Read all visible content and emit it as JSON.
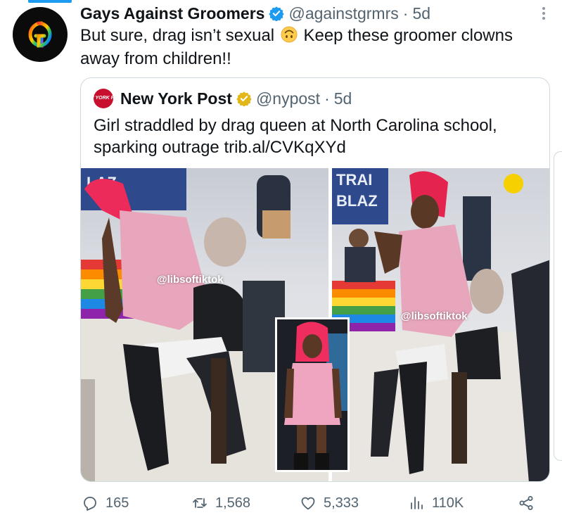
{
  "tweet": {
    "display_name": "Gays Against Groomers",
    "handle": "@againstgrmrs",
    "separator": "·",
    "time": "5d",
    "text_before_emoji": "But sure, drag isn’t sexual ",
    "text_after_emoji": " Keep these groomer clowns away from children!!",
    "avatar_icon": "gg-rainbow-logo-icon",
    "verified_icon": "verified-badge-icon",
    "verified_color": "#1d9bf0",
    "emoji": "upside-down-face-emoji"
  },
  "quote": {
    "display_name": "New York Post",
    "handle": "@nypost",
    "separator": "·",
    "time": "5d",
    "avatar_text": "NEW YORK POST",
    "avatar_color": "#c8102e",
    "verified_icon": "gold-verified-badge-icon",
    "verified_color": "#e2b719",
    "text": "Girl straddled by drag queen at North Carolina school, sparking outrage trib.al/CVKqXYd",
    "media": {
      "watermark_left": "@libsoftiktok",
      "watermark_right": "@libsoftiktok",
      "sign_left": "LAZ",
      "sign_right_line1": "TRAI",
      "sign_right_line2": "BLAZ"
    }
  },
  "actions": {
    "replies": "165",
    "retweets": "1,568",
    "likes": "5,333",
    "views": "110K"
  },
  "colors": {
    "text_primary": "#0f1419",
    "text_secondary": "#536471",
    "border": "#cfd9de",
    "accent": "#1d9bf0"
  }
}
